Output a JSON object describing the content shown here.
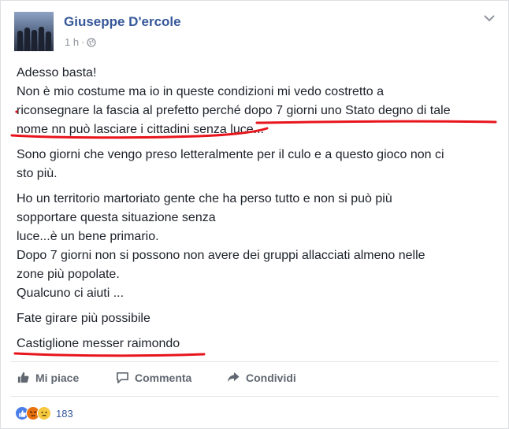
{
  "post": {
    "author": "Giuseppe D'ercole",
    "time": "1 h",
    "separator": "·",
    "paragraphs": [
      "Adesso basta!\nNon è mio costume ma io in queste condizioni mi vedo costretto a\nriconsegnare la fascia al prefetto perché dopo 7 giorni uno Stato degno di tale\nnome nn può lasciare i cittadini senza luce...",
      "Sono giorni che vengo preso letteralmente per il culo e a questo gioco non ci\nsto più.",
      "Ho un territorio martoriato gente che ha perso tutto e non si può più\nsopportare questa situazione senza\nluce...è un bene primario.\nDopo 7 giorni non si possono non avere dei gruppi allacciati almeno nelle\nzone più popolate.\nQualcuno ci aiuti ...",
      "Fate girare più possibile",
      "Castiglione messer raimondo"
    ]
  },
  "actions": {
    "like": "Mi piace",
    "comment": "Commenta",
    "share": "Condividi"
  },
  "reactions": {
    "count": "183",
    "icons": [
      "like-reaction-icon",
      "angry-reaction-icon",
      "sad-reaction-icon"
    ]
  },
  "colors": {
    "author": "#365899",
    "underline": "#e8141c",
    "text": "#1d2129",
    "muted": "#90949c"
  }
}
